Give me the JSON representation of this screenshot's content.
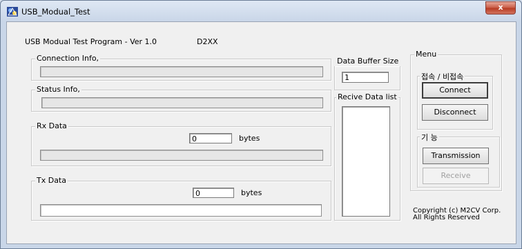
{
  "window": {
    "title": "USB_Modual_Test",
    "close_label": "x"
  },
  "header": {
    "program_title": "USB Modual Test Program  - Ver 1.0",
    "driver_label": "D2XX"
  },
  "connection_info": {
    "label": "Connection Info,",
    "value": ""
  },
  "status_info": {
    "label": "Status Info,",
    "value": ""
  },
  "rx_data": {
    "label": "Rx Data",
    "count": "0",
    "unit": "bytes",
    "content": ""
  },
  "tx_data": {
    "label": "Tx Data",
    "count": "0",
    "unit": "bytes",
    "content": ""
  },
  "data_buffer": {
    "label": "Data Buffer Size",
    "value": "1"
  },
  "receive_list": {
    "label": "Recive Data list",
    "items": []
  },
  "menu": {
    "label": "Menu",
    "connection_group": {
      "label": "접속 / 비접속",
      "connect_label": "Connect",
      "disconnect_label": "Disconnect"
    },
    "function_group": {
      "label": "기 능",
      "transmission_label": "Transmission",
      "receive_label": "Receive"
    }
  },
  "copyright": {
    "line1": "Copyright (c) M2CV Corp.",
    "line2": "All Rights Reserved"
  },
  "colors": {
    "titlebar": "#dfe8f4",
    "close_button": "#c85a44",
    "client_background": "#f0f0f0"
  }
}
